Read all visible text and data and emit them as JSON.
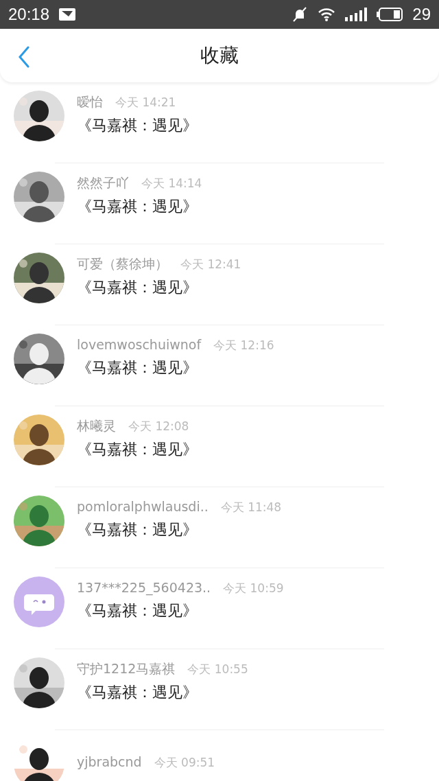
{
  "status_bar": {
    "time": "20:18",
    "battery": "29"
  },
  "header": {
    "title": "收藏"
  },
  "items": [
    {
      "name": "暧怡",
      "time": "今天 14:21",
      "title": "《马嘉祺：遇见》"
    },
    {
      "name": "然然子吖",
      "time": "今天 14:14",
      "title": "《马嘉祺：遇见》"
    },
    {
      "name": "可爱（蔡徐坤）",
      "time": "今天 12:41",
      "title": "《马嘉祺：遇见》"
    },
    {
      "name": "lovemwoschuiwnof",
      "time": "今天 12:16",
      "title": "《马嘉祺：遇见》"
    },
    {
      "name": "林曦灵",
      "time": "今天 12:08",
      "title": "《马嘉祺：遇见》"
    },
    {
      "name": "pomloralphwlausdi..",
      "time": "今天 11:48",
      "title": "《马嘉祺：遇见》"
    },
    {
      "avatar": {
        "kind": "default"
      },
      "name": "137***225_560423..",
      "time": "今天 10:59",
      "title": "《马嘉祺：遇见》"
    },
    {
      "name": "守护1212马嘉祺",
      "time": "今天 10:55",
      "title": "《马嘉祺：遇见》"
    },
    {
      "name": "yjbrabcnd",
      "time": "今天 09:51"
    }
  ]
}
